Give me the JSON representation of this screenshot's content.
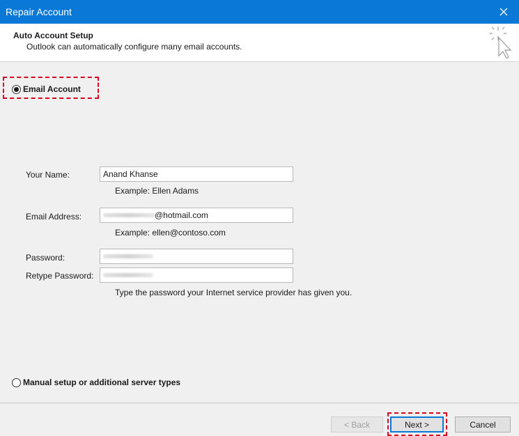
{
  "window": {
    "title": "Repair Account"
  },
  "header": {
    "title": "Auto Account Setup",
    "subtitle": "Outlook can automatically configure many email accounts."
  },
  "options": {
    "email_account": "Email Account",
    "manual_setup": "Manual setup or additional server types"
  },
  "form": {
    "name_label": "Your Name:",
    "name_value": "Anand Khanse",
    "name_example": "Example: Ellen Adams",
    "email_label": "Email Address:",
    "email_suffix": "@hotmail.com",
    "email_example": "Example: ellen@contoso.com",
    "password_label": "Password:",
    "retype_label": "Retype Password:",
    "password_hint": "Type the password your Internet service provider has given you."
  },
  "buttons": {
    "back": "< Back",
    "next": "Next >",
    "cancel": "Cancel"
  },
  "colors": {
    "titlebar": "#0a78d7",
    "highlight": "#d9001b"
  }
}
